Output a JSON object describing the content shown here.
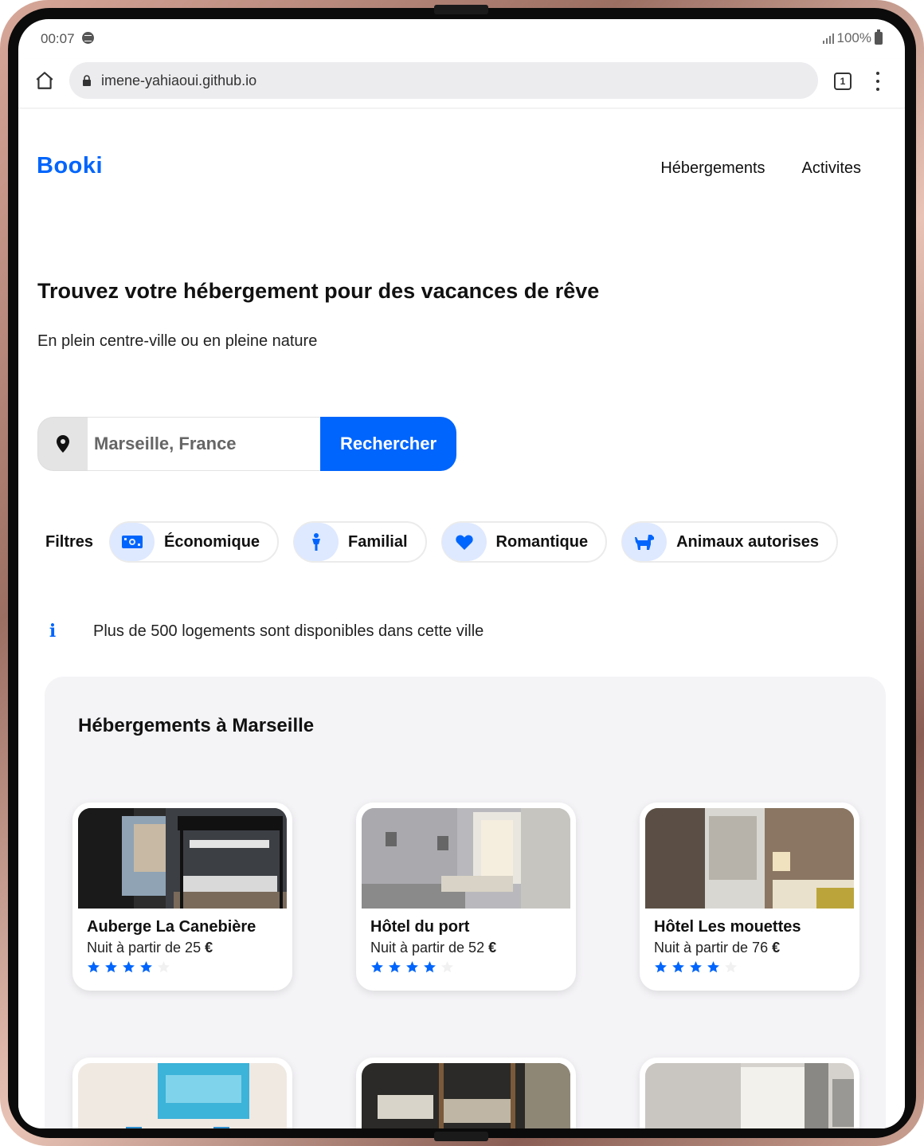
{
  "status": {
    "time": "00:07",
    "battery": "100%"
  },
  "browser": {
    "url": "imene-yahiaoui.github.io",
    "tab_count": "1"
  },
  "header": {
    "logo": "Booki",
    "nav": [
      "Hébergements",
      "Activites"
    ]
  },
  "hero": {
    "title": "Trouvez votre hébergement pour des vacances de rêve",
    "subtitle": "En plein centre-ville ou en pleine nature"
  },
  "search": {
    "placeholder": "Marseille, France",
    "button": "Rechercher"
  },
  "filters": {
    "label": "Filtres",
    "items": [
      {
        "label": "Économique",
        "icon": "money-icon"
      },
      {
        "label": "Familial",
        "icon": "person-icon"
      },
      {
        "label": "Romantique",
        "icon": "heart-icon"
      },
      {
        "label": "Animaux autorises",
        "icon": "dog-icon"
      }
    ]
  },
  "info": {
    "text": "Plus de 500 logements sont disponibles dans cette ville"
  },
  "listing": {
    "title": "Hébergements à Marseille",
    "cards": [
      {
        "name": "Auberge La Canebière",
        "price_prefix": "Nuit à partir de 25",
        "currency": "€",
        "rating": 4,
        "max_rating": 5
      },
      {
        "name": "Hôtel du port",
        "price_prefix": "Nuit à partir de 52",
        "currency": "€",
        "rating": 4,
        "max_rating": 5
      },
      {
        "name": "Hôtel Les mouettes",
        "price_prefix": "Nuit à partir de 76",
        "currency": "€",
        "rating": 4,
        "max_rating": 5
      }
    ]
  },
  "colors": {
    "accent": "#0065fc",
    "chip_bg": "#dee9ff",
    "listing_bg": "#f4f3f6"
  }
}
